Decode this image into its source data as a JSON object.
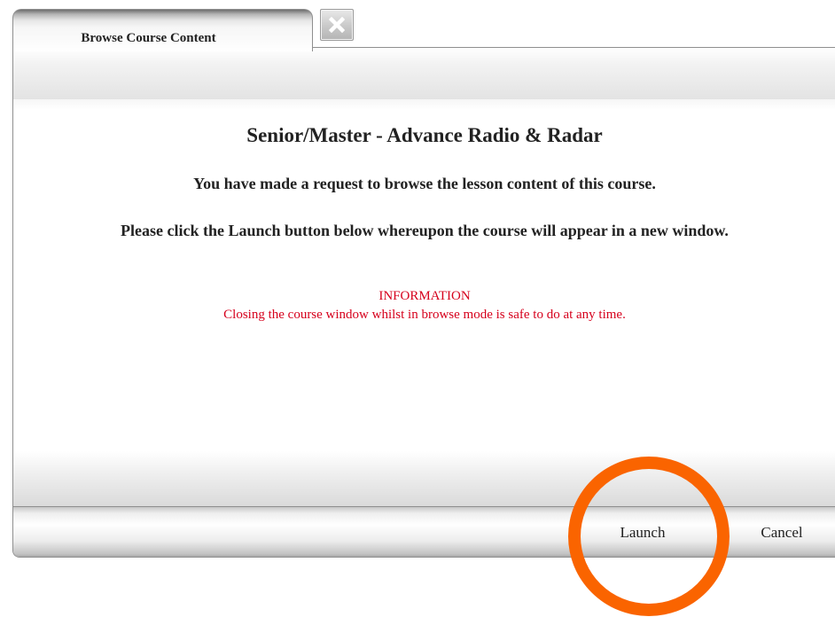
{
  "tab": {
    "label": "Browse Course Content",
    "close_icon": "close-icon"
  },
  "content": {
    "course_title": "Senior/Master - Advance Radio & Radar",
    "message_request": "You have made a request to browse the lesson content of this course.",
    "message_instruction": "Please click the Launch button below whereupon the course will appear in a new window.",
    "info_heading": "INFORMATION",
    "info_text": "Closing the course window whilst in browse mode is safe to do at any time."
  },
  "footer": {
    "launch_label": "Launch",
    "cancel_label": "Cancel"
  },
  "colors": {
    "info_text": "#d6001c",
    "highlight_ring": "#fa6400"
  }
}
